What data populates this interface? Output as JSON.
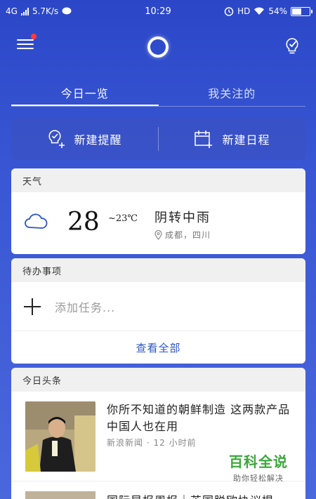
{
  "status_bar": {
    "network": "4G",
    "speed": "5.7K/s",
    "time": "10:29",
    "hd": "HD",
    "battery": "54%",
    "battery_level": 0.54
  },
  "tabs": [
    "今日一览",
    "我关注的"
  ],
  "actions": {
    "reminder": "新建提醒",
    "schedule": "新建日程"
  },
  "weather": {
    "header": "天气",
    "temp": "28",
    "temp_low": "~23℃",
    "condition": "阴转中雨",
    "location": "成都，四川"
  },
  "todo": {
    "header": "待办事项",
    "placeholder": "添加任务...",
    "view_all": "查看全部"
  },
  "news": {
    "header": "今日头条",
    "items": [
      {
        "title": "你所不知道的朝鲜制造 这两款产品中国人也在用",
        "source": "新浪新闻",
        "time": "12 小时前"
      },
      {
        "title": "国际早报周报｜英国脱欧协议提"
      }
    ]
  },
  "watermark": {
    "main": "百科全说",
    "sub": "助你轻松解决"
  },
  "colors": {
    "background": "#3450cc",
    "accent": "#2b55c8",
    "notification_dot": "#ff3b3b"
  }
}
